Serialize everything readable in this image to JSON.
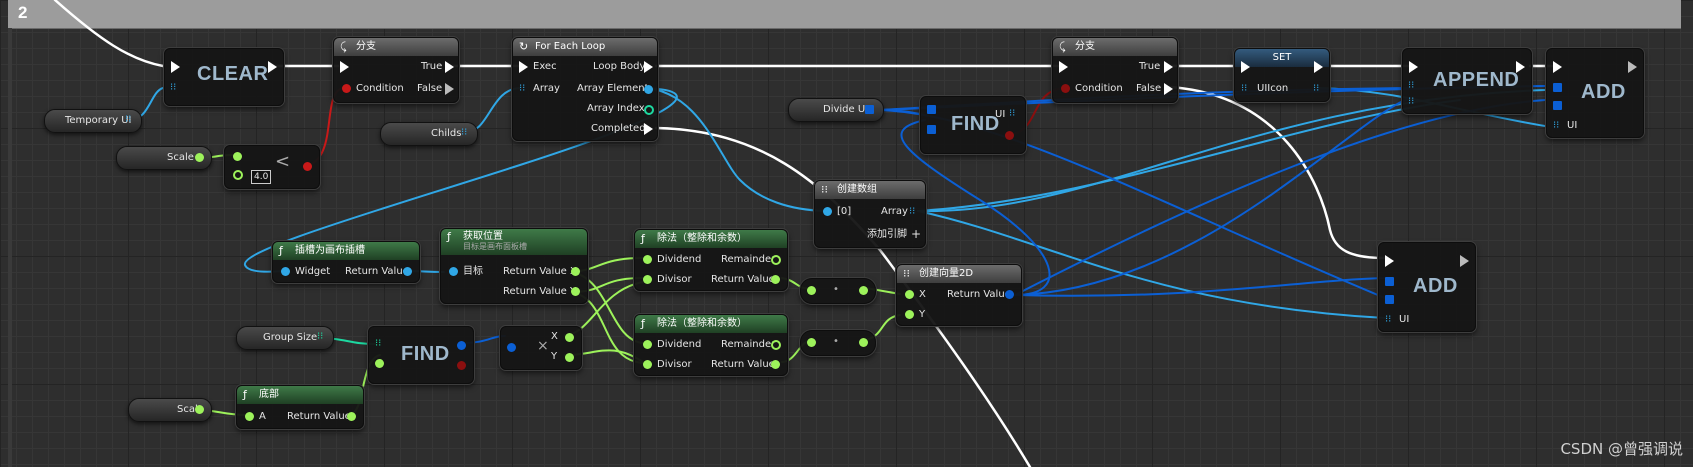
{
  "comment_title": "2",
  "watermark": "CSDN @曾强调说",
  "colors": {
    "exec": "#ffffff",
    "object": "#30a7e6",
    "float": "#9df25b",
    "int": "#1dd8a0",
    "bool": "#c81919",
    "vector2d": "#0b5fd4"
  },
  "nodes": {
    "clear": {
      "title": "CLEAR"
    },
    "branch1": {
      "title": "分支",
      "true_label": "True",
      "false_label": "False",
      "condition_label": "Condition"
    },
    "foreach": {
      "title": "For Each Loop",
      "exec_label": "Exec",
      "array_label": "Array",
      "loop_body": "Loop Body",
      "array_element": "Array Element",
      "array_index": "Array Index",
      "completed": "Completed"
    },
    "branch2": {
      "title": "分支",
      "true_label": "True",
      "false_label": "False",
      "condition_label": "Condition"
    },
    "set": {
      "title": "SET",
      "pin_label": "UIIcon"
    },
    "append": {
      "title": "APPEND"
    },
    "add1": {
      "title": "ADD",
      "pin_label": "UI"
    },
    "add2": {
      "title": "ADD",
      "pin_label": "UI"
    },
    "find1": {
      "title": "FIND",
      "pin_label": "UI"
    },
    "find2": {
      "title": "FIND"
    },
    "compare": {
      "value": "4.0",
      "op_symbol": "<"
    },
    "make_array": {
      "title": "创建数组",
      "index_label": "[0]",
      "array_label": "Array",
      "add_pin": "添加引脚"
    },
    "slot_as_canvas": {
      "title": "插槽为画布插槽",
      "widget_label": "Widget",
      "return_label": "Return Value"
    },
    "get_position": {
      "title": "获取位置",
      "subtitle": "目标是画布面板槽",
      "target_label": "目标",
      "rx_label": "Return Value X",
      "ry_label": "Return Value Y"
    },
    "divide1": {
      "title": "除法（整除和余数）",
      "dividend_label": "Dividend",
      "divisor_label": "Divisor",
      "remainder_label": "Remainder",
      "return_label": "Return Value"
    },
    "divide2": {
      "title": "除法（整除和余数）",
      "dividend_label": "Dividend",
      "divisor_label": "Divisor",
      "remainder_label": "Remainder",
      "return_label": "Return Value"
    },
    "make_vector": {
      "title": "创建向量2D",
      "x_label": "X",
      "y_label": "Y",
      "return_label": "Return Value"
    },
    "floor": {
      "title": "底部",
      "a_label": "A",
      "return_label": "Return Value"
    },
    "break_vec": {
      "x_label": "X",
      "y_label": "Y",
      "op_symbol": "×"
    },
    "mult1": {
      "op_symbol": "•"
    },
    "mult2": {
      "op_symbol": "•"
    }
  },
  "variables": {
    "temporary_ui": "Temporary UI",
    "scale_1": "Scale",
    "childs": "Childs",
    "divide_ui": "Divide UI",
    "group_size": "Group Size",
    "scale_2": "Scale"
  }
}
